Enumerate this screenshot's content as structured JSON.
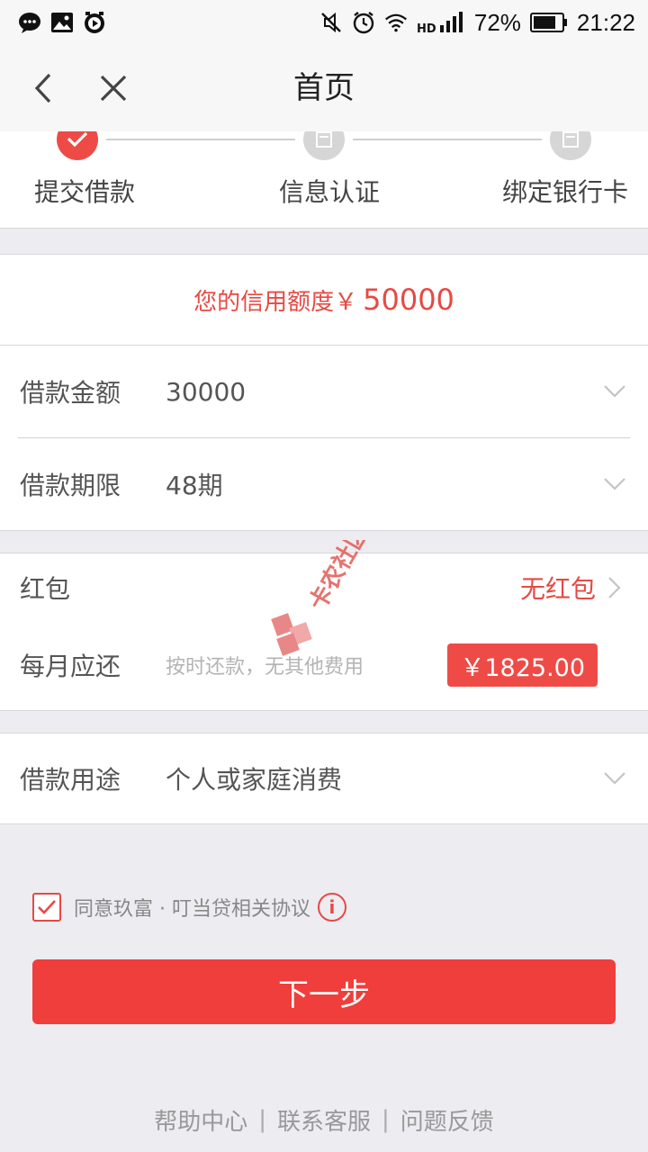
{
  "status_bar": {
    "battery": "72%",
    "time": "21:22",
    "network": "HD"
  },
  "nav": {
    "title": "首页"
  },
  "steps": [
    {
      "label": "提交借款",
      "state": "done"
    },
    {
      "label": "信息认证",
      "state": "todo"
    },
    {
      "label": "绑定银行卡",
      "state": "todo"
    }
  ],
  "credit": {
    "label": "您的信用额度￥",
    "amount": "50000"
  },
  "loan": {
    "amount_label": "借款金额",
    "amount_value": "30000",
    "term_label": "借款期限",
    "term_value": "48期"
  },
  "redpack": {
    "label": "红包",
    "value": "无红包"
  },
  "monthly": {
    "label": "每月应还",
    "hint": "按时还款，无其他费用",
    "amount": "￥1825.00"
  },
  "purpose": {
    "label": "借款用途",
    "value": "个人或家庭消费"
  },
  "agreement": {
    "checked": true,
    "text": "同意玖富 · 叮当贷相关协议"
  },
  "next_button": "下一步",
  "footer": {
    "links": [
      "帮助中心",
      "联系客服",
      "问题反馈"
    ],
    "separator": "|"
  },
  "watermark_text": "卡农社区",
  "colors": {
    "accent": "#ef3e3b",
    "accent_text": "#e64a44",
    "page_bg": "#ececf1"
  }
}
